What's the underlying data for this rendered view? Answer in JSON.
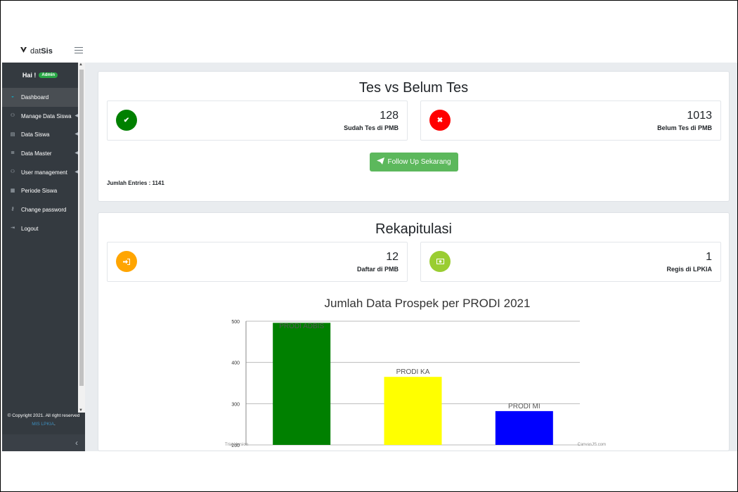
{
  "brand": {
    "prefix": "dat",
    "name": "Sis"
  },
  "sidebar": {
    "greeting": "Hai !",
    "role_badge": "Admin",
    "items": [
      {
        "label": "Dashboard",
        "icon": "dashboard-icon",
        "active": true
      },
      {
        "label": "Manage Data Siswa",
        "icon": "users-icon",
        "has_caret": true
      },
      {
        "label": "Data Siswa",
        "icon": "table-icon",
        "has_caret": true
      },
      {
        "label": "Data Master",
        "icon": "database-icon",
        "has_caret": true
      },
      {
        "label": "User management",
        "icon": "users-icon",
        "has_caret": true
      },
      {
        "label": "Periode Siswa",
        "icon": "calendar-icon"
      },
      {
        "label": "Change password",
        "icon": "key-icon"
      },
      {
        "label": "Logout",
        "icon": "logout-icon"
      }
    ],
    "footer_text": "© Copyright 2021. All right reserved",
    "footer_link": "MIS LPKIA",
    "footer_suffix": "."
  },
  "tes_card": {
    "title": "Tes vs Belum Tes",
    "box1": {
      "value": "128",
      "label": "Sudah Tes di PMB",
      "icon": "check-icon",
      "color": "#008000"
    },
    "box2": {
      "value": "1013",
      "label": "Belum Tes di PMB",
      "icon": "times-icon",
      "color": "#ff0000"
    },
    "button_label": "Follow Up Sekarang",
    "entries_label": "Jumlah Entries : 1141"
  },
  "rekap_card": {
    "title": "Rekapitulasi",
    "box1": {
      "value": "12",
      "label": "Daftar di PMB",
      "icon": "sign-in-icon",
      "color": "#ffa500"
    },
    "box2": {
      "value": "1",
      "label": "Regis di LPKIA",
      "icon": "money-icon",
      "color": "#9acd32"
    }
  },
  "chart_data": {
    "type": "bar",
    "title": "Jumlah Data Prospek per PRODI 2021",
    "categories": [
      "PRODI ADBIS",
      "PRODI KA",
      "PRODI MI"
    ],
    "values": [
      496,
      365,
      282
    ],
    "colors": [
      "#008000",
      "#ffff00",
      "#0000ff"
    ],
    "index_labels": [
      "PRODI ADBIS",
      "PRODI KA",
      "PRODI MI"
    ],
    "ylim": [
      200,
      500
    ],
    "yticks": [
      200,
      300,
      400,
      500
    ],
    "grid": true,
    "watermark_left": "Trial Version",
    "watermark_right": "CanvasJS.com"
  }
}
